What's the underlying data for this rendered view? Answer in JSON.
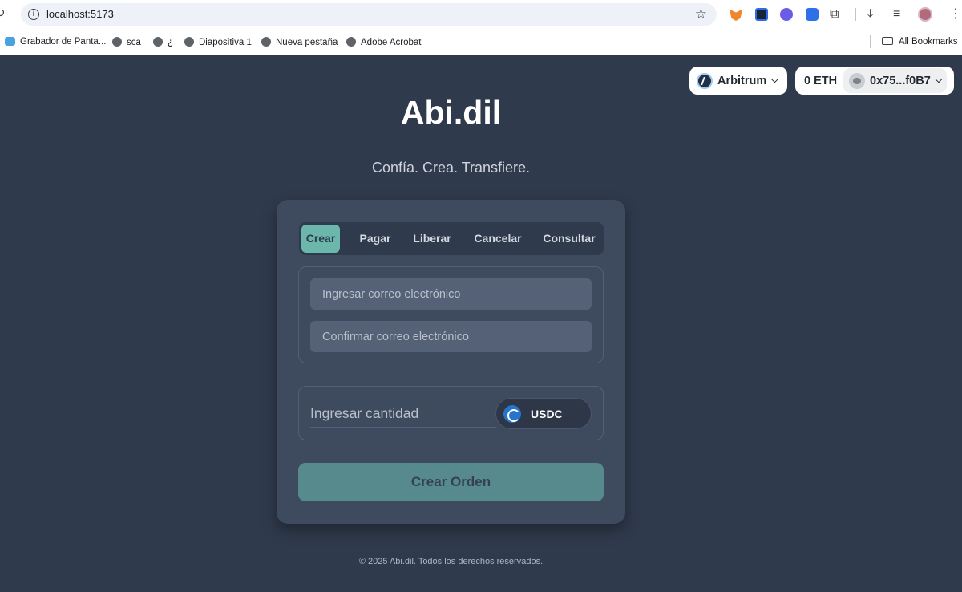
{
  "browser": {
    "url": "localhost:5173",
    "bookmarks": [
      {
        "label": "Grabador de Panta..."
      },
      {
        "label": "sca"
      },
      {
        "label": "¿"
      },
      {
        "label": "Diapositiva 1"
      },
      {
        "label": "Nueva pestaña"
      },
      {
        "label": "Adobe Acrobat"
      }
    ],
    "all_bookmarks_label": "All Bookmarks"
  },
  "wallet": {
    "network": "Arbitrum",
    "balance": "0 ETH",
    "address": "0x75...f0B7"
  },
  "app": {
    "title": "Abi.dil",
    "tagline": "Confía. Crea. Transfiere.",
    "tabs": [
      {
        "label": "Crear"
      },
      {
        "label": "Pagar"
      },
      {
        "label": "Liberar"
      },
      {
        "label": "Cancelar"
      },
      {
        "label": "Consultar"
      }
    ],
    "form": {
      "email_placeholder": "Ingresar correo electrónico",
      "confirm_email_placeholder": "Confirmar correo electrónico",
      "amount_placeholder": "Ingresar cantidad",
      "token": "USDC",
      "submit_label": "Crear Orden"
    },
    "footer": "© 2025 Abi.dil. Todos los derechos reservados."
  },
  "colors": {
    "background": "#2f3a4c",
    "card": "#3e4a5e",
    "accent": "#6cb7ac",
    "button_disabled": "#578a8c"
  }
}
